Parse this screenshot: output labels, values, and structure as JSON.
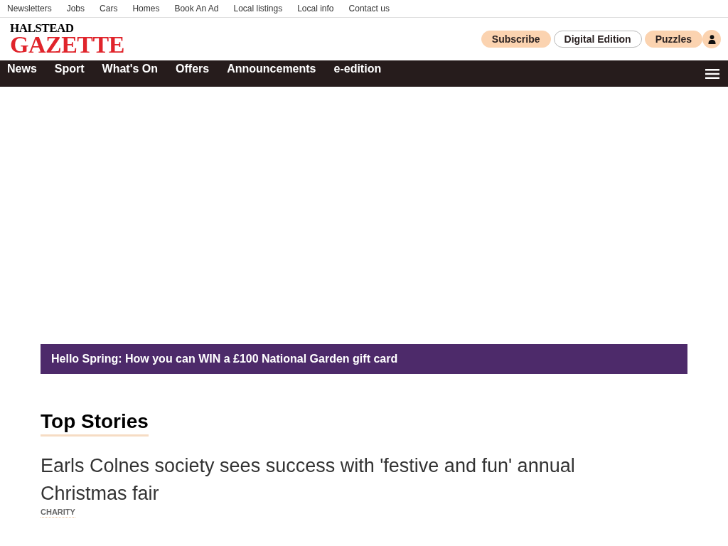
{
  "top_links": [
    "Newsletters",
    "Jobs",
    "Cars",
    "Homes",
    "Book An Ad",
    "Local listings",
    "Local info",
    "Contact us"
  ],
  "logo": {
    "line_1": "HALSTEAD",
    "line_2": "GAZETTE"
  },
  "header_buttons": [
    {
      "label": "Subscribe",
      "kind": "filled"
    },
    {
      "label": "Digital Edition",
      "kind": "outline"
    },
    {
      "label": "Puzzles",
      "kind": "filled"
    }
  ],
  "nav": [
    "News",
    "Sport",
    "What's On",
    "Offers",
    "Announcements",
    "e-edition"
  ],
  "promo_banner": "Hello Spring: How you can WIN a £100 National Garden gift card",
  "section_title": "Top Stories",
  "stories": [
    {
      "headline": "Earls Colnes society sees success with 'festive and fun' annual Christmas fair",
      "category": "CHARITY"
    }
  ]
}
